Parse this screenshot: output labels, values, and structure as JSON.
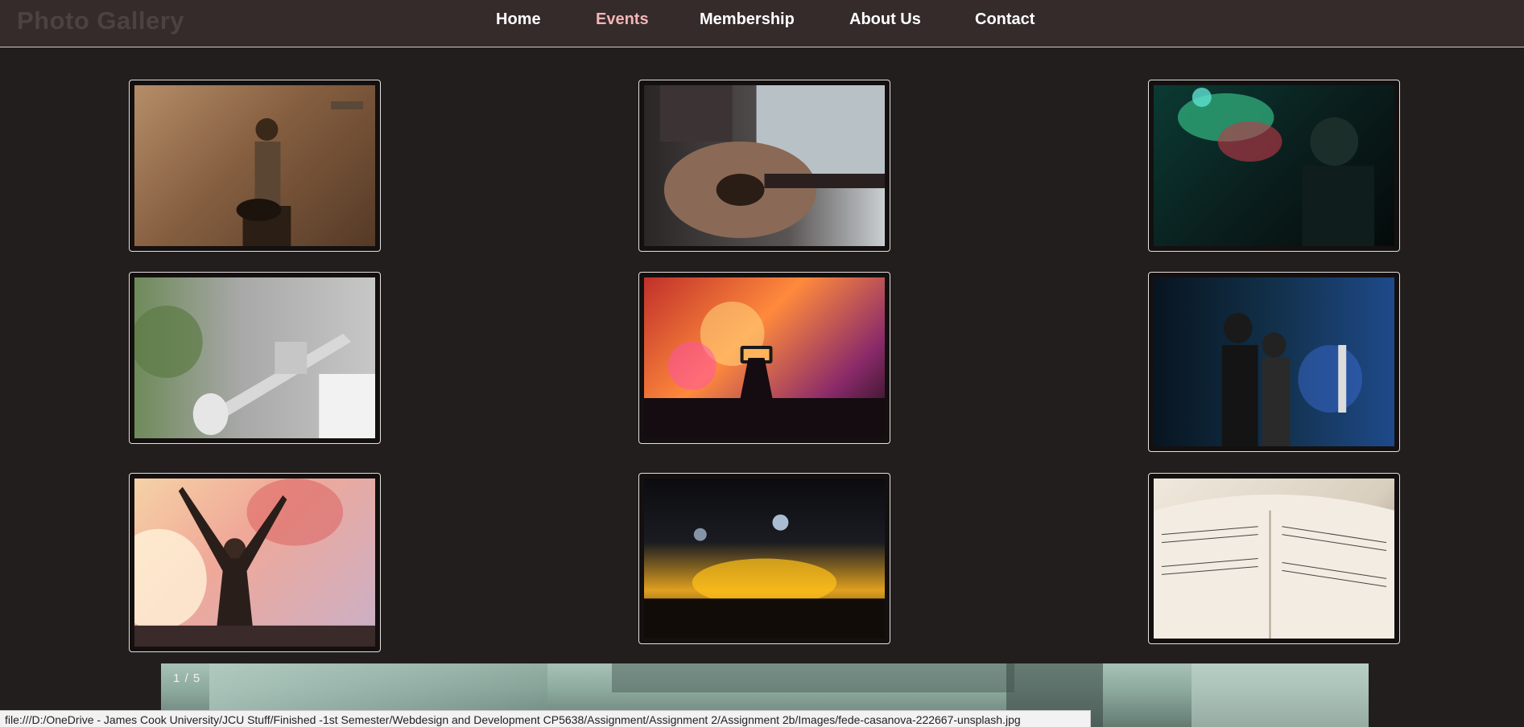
{
  "brand": {
    "title": "Photo Gallery"
  },
  "nav": {
    "items": [
      {
        "label": "Home",
        "active": false
      },
      {
        "label": "Events",
        "active": true
      },
      {
        "label": "Membership",
        "active": false
      },
      {
        "label": "About Us",
        "active": false
      },
      {
        "label": "Contact",
        "active": false
      }
    ]
  },
  "gallery": {
    "images": [
      {
        "alt": "singer-with-guitar"
      },
      {
        "alt": "acoustic-guitar"
      },
      {
        "alt": "singer-green-lights"
      },
      {
        "alt": "trumpet"
      },
      {
        "alt": "concert-phone"
      },
      {
        "alt": "crowd-blue-stage"
      },
      {
        "alt": "dancing-woman"
      },
      {
        "alt": "stage-crowd-yellow"
      },
      {
        "alt": "sheet-music"
      }
    ]
  },
  "slideshow": {
    "counter": "1 / 5"
  },
  "statusbar": {
    "url": "file:///D:/OneDrive - James Cook University/JCU Stuff/Finished -1st Semester/Webdesign and Development  CP5638/Assignment/Assignment 2/Assignment 2b/Images/fede-casanova-222667-unsplash.jpg"
  },
  "colors": {
    "background": "#231e1e",
    "navbar": "#352b2b",
    "active_link": "#f3b6b6"
  }
}
